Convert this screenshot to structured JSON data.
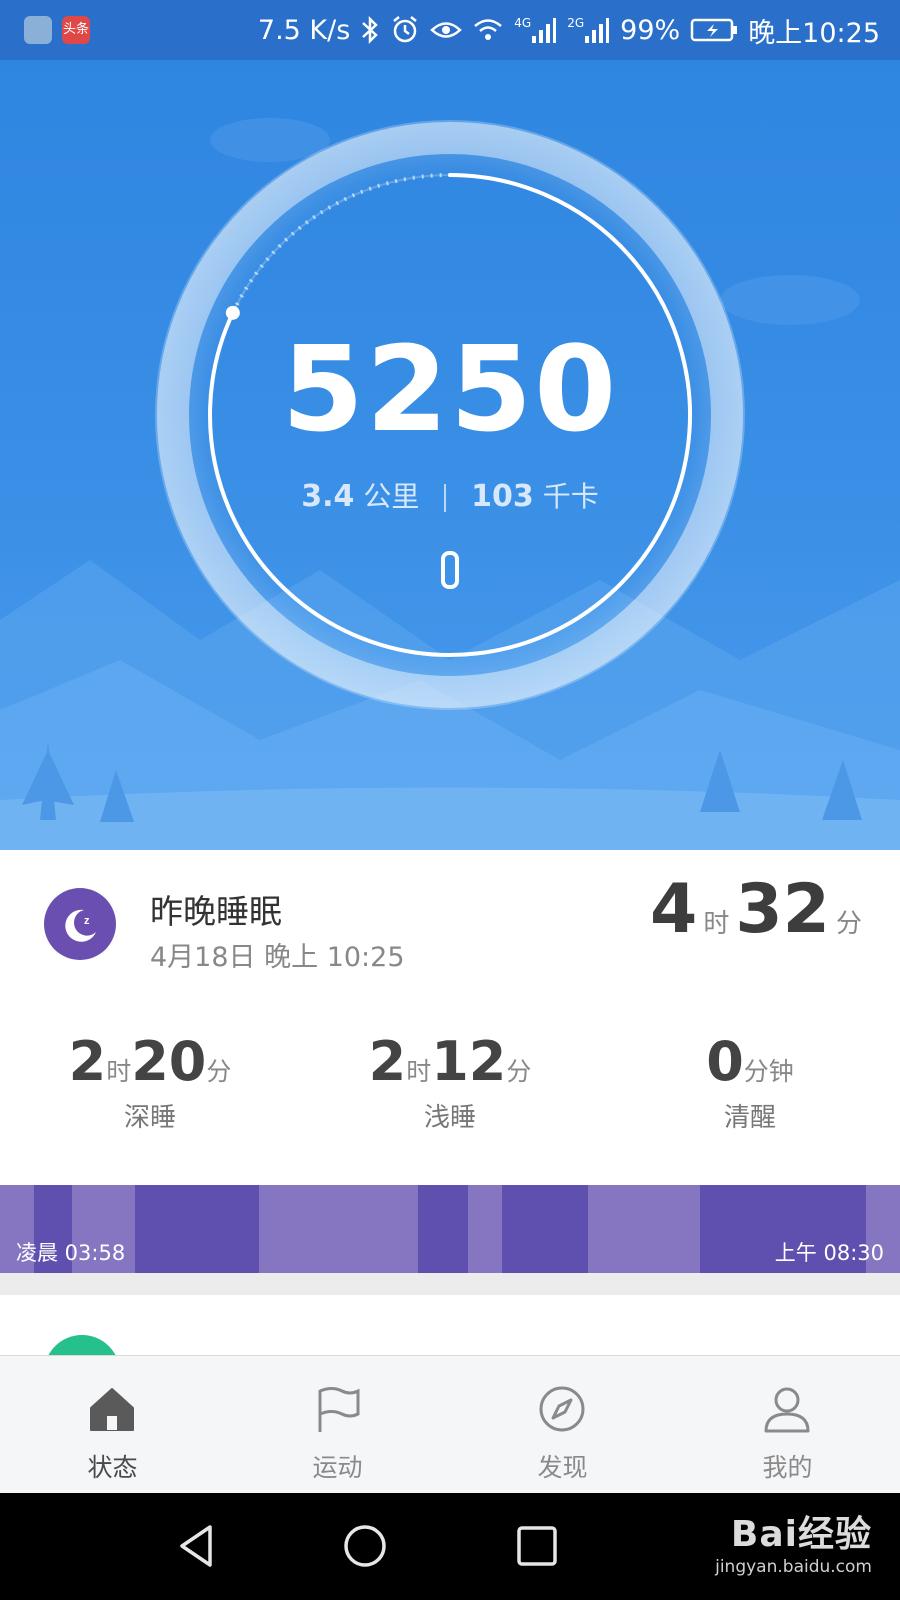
{
  "status_bar": {
    "app_icon_1": "mi-app-icon",
    "app_icon_2": "头条",
    "net_speed": "7.5 K/s",
    "net_4g": "4G",
    "net_2g": "2G",
    "battery": "99%",
    "time": "晚上10:25"
  },
  "activity": {
    "steps": "5250",
    "distance_value": "3.4",
    "distance_unit": "公里",
    "calories_value": "103",
    "calories_unit": "千卡",
    "goal_progress": 0.82,
    "band_icon": "band-icon"
  },
  "sleep": {
    "title": "昨晚睡眠",
    "date": "4月18日 晚上 10:25",
    "total_hours": "4",
    "total_hours_unit": "时",
    "total_minutes": "32",
    "total_minutes_unit": "分",
    "stats": [
      {
        "h": "2",
        "h_unit": "时",
        "m": "20",
        "m_unit": "分",
        "label": "深睡"
      },
      {
        "h": "2",
        "h_unit": "时",
        "m": "12",
        "m_unit": "分",
        "label": "浅睡"
      },
      {
        "h": "",
        "h_unit": "",
        "m": "0",
        "m_unit": "分钟",
        "label": "清醒"
      }
    ],
    "timeline_start": "凌晨 03:58",
    "timeline_end": "上午 08:30",
    "colors": {
      "deep": "#5f4fae",
      "light": "#8676c2",
      "icon": "#6a4fb0"
    }
  },
  "tabs": [
    {
      "label": "状态",
      "icon": "home-icon",
      "active": true
    },
    {
      "label": "运动",
      "icon": "flag-icon",
      "active": false
    },
    {
      "label": "发现",
      "icon": "compass-icon",
      "active": false
    },
    {
      "label": "我的",
      "icon": "person-icon",
      "active": false
    }
  ],
  "watermark": {
    "brand": "Bai经验",
    "url": "jingyan.baidu.com"
  }
}
